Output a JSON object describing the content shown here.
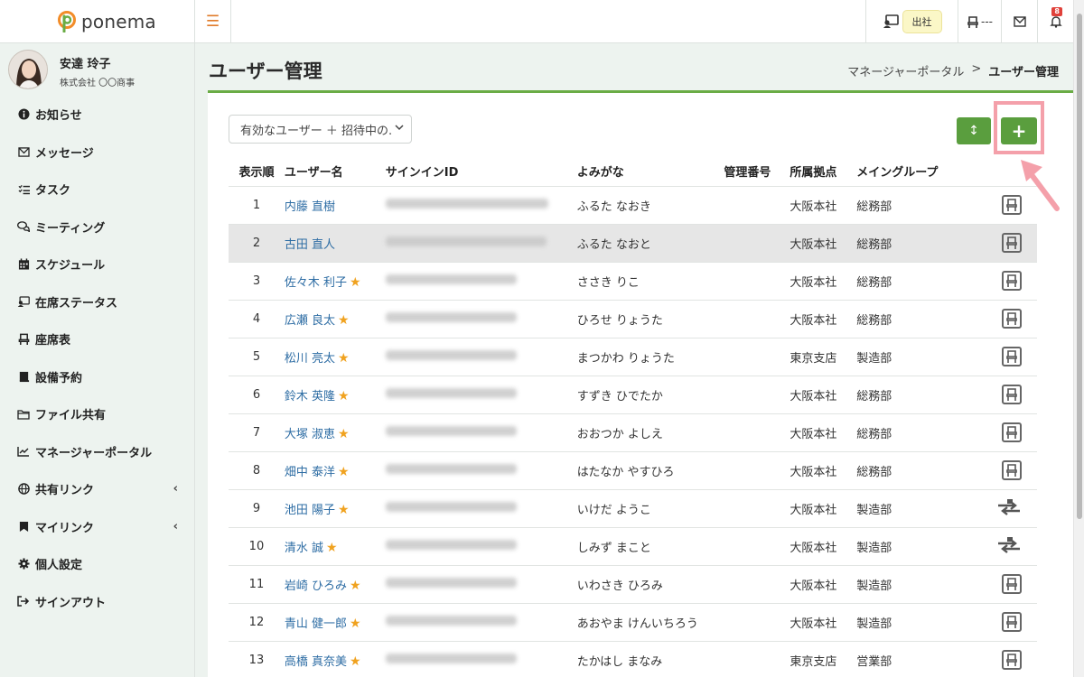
{
  "app": {
    "brand": "ponema"
  },
  "topbar": {
    "attendance_status": "出社",
    "seat_status": "---",
    "notification_count": "8"
  },
  "user": {
    "name": "安達 玲子",
    "company": "株式会社 〇〇商事"
  },
  "sidebar": {
    "items": [
      {
        "label": "お知らせ",
        "icon": "info-icon"
      },
      {
        "label": "メッセージ",
        "icon": "mail-icon"
      },
      {
        "label": "タスク",
        "icon": "task-list-icon"
      },
      {
        "label": "ミーティング",
        "icon": "chat-icon"
      },
      {
        "label": "スケジュール",
        "icon": "calendar-icon"
      },
      {
        "label": "在席ステータス",
        "icon": "presence-icon"
      },
      {
        "label": "座席表",
        "icon": "seat-icon"
      },
      {
        "label": "設備予約",
        "icon": "book-icon"
      },
      {
        "label": "ファイル共有",
        "icon": "folder-icon"
      },
      {
        "label": "マネージャーポータル",
        "icon": "chart-line-icon"
      },
      {
        "label": "共有リンク",
        "icon": "globe-icon",
        "expandable": true
      },
      {
        "label": "マイリンク",
        "icon": "bookmark-icon",
        "expandable": true
      },
      {
        "label": "個人設定",
        "icon": "gear-icon"
      },
      {
        "label": "サインアウト",
        "icon": "sign-out-icon"
      }
    ]
  },
  "page": {
    "title": "ユーザー管理",
    "breadcrumb": {
      "parent": "マネージャーポータル",
      "separator": ">",
      "current": "ユーザー管理"
    }
  },
  "filter": {
    "selected": "有効なユーザー ＋ 招待中の."
  },
  "buttons": {
    "sort": "↕",
    "add": "+"
  },
  "table": {
    "headers": [
      "表示順",
      "ユーザー名",
      "サインインID",
      "よみがな",
      "管理番号",
      "所属拠点",
      "メイングループ"
    ],
    "rows": [
      {
        "order": "1",
        "name": "内藤 直樹",
        "star": false,
        "kana": "ふるた なおき",
        "mgmt": "",
        "site": "大阪本社",
        "group": "総務部",
        "action": "seat"
      },
      {
        "order": "2",
        "name": "古田 直人",
        "star": false,
        "kana": "ふるた なおと",
        "mgmt": "",
        "site": "大阪本社",
        "group": "総務部",
        "action": "seat"
      },
      {
        "order": "3",
        "name": "佐々木 利子",
        "star": true,
        "kana": "ささき りこ",
        "mgmt": "",
        "site": "大阪本社",
        "group": "総務部",
        "action": "seat"
      },
      {
        "order": "4",
        "name": "広瀬 良太",
        "star": true,
        "kana": "ひろせ りょうた",
        "mgmt": "",
        "site": "大阪本社",
        "group": "総務部",
        "action": "seat"
      },
      {
        "order": "5",
        "name": "松川 亮太",
        "star": true,
        "kana": "まつかわ りょうた",
        "mgmt": "",
        "site": "東京支店",
        "group": "製造部",
        "action": "seat"
      },
      {
        "order": "6",
        "name": "鈴木 英隆",
        "star": true,
        "kana": "すずき ひでたか",
        "mgmt": "",
        "site": "大阪本社",
        "group": "総務部",
        "action": "seat"
      },
      {
        "order": "7",
        "name": "大塚 淑恵",
        "star": true,
        "kana": "おおつか よしえ",
        "mgmt": "",
        "site": "大阪本社",
        "group": "総務部",
        "action": "seat"
      },
      {
        "order": "8",
        "name": "畑中 泰洋",
        "star": true,
        "kana": "はたなか やすひろ",
        "mgmt": "",
        "site": "大阪本社",
        "group": "総務部",
        "action": "seat"
      },
      {
        "order": "9",
        "name": "池田 陽子",
        "star": true,
        "kana": "いけだ ようこ",
        "mgmt": "",
        "site": "大阪本社",
        "group": "製造部",
        "action": "swap"
      },
      {
        "order": "10",
        "name": "清水 誠",
        "star": true,
        "kana": "しみず まこと",
        "mgmt": "",
        "site": "大阪本社",
        "group": "製造部",
        "action": "swap"
      },
      {
        "order": "11",
        "name": "岩崎 ひろみ",
        "star": true,
        "kana": "いわさき ひろみ",
        "mgmt": "",
        "site": "大阪本社",
        "group": "製造部",
        "action": "seat"
      },
      {
        "order": "12",
        "name": "青山 健一郎",
        "star": true,
        "kana": "あおやま けんいちろう",
        "mgmt": "",
        "site": "大阪本社",
        "group": "製造部",
        "action": "seat"
      },
      {
        "order": "13",
        "name": "高橋 真奈美",
        "star": true,
        "kana": "たかはし まなみ",
        "mgmt": "",
        "site": "東京支店",
        "group": "営業部",
        "action": "seat"
      }
    ]
  },
  "colors": {
    "accent": "#5a9e3e",
    "link": "#2e6da4",
    "star": "#f0a21f",
    "highlight": "#f4a0aa"
  }
}
